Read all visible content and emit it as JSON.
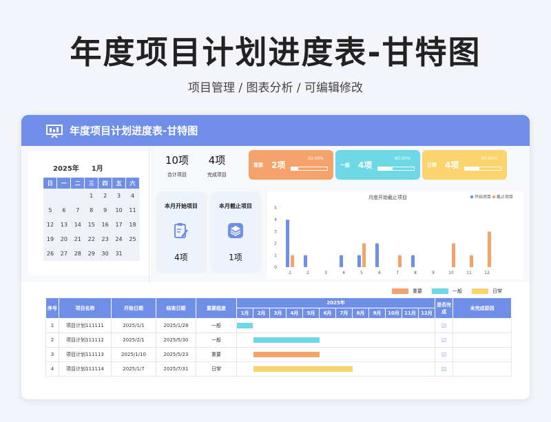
{
  "page": {
    "title": "年度项目计划进度表-甘特图",
    "subtitle": "项目管理 / 图表分析 / 可编辑修改"
  },
  "sheet": {
    "banner_title": "年度项目计划进度表-甘特图",
    "calendar": {
      "year_label": "2025年",
      "month_label": "1月",
      "weekdays": [
        "日",
        "一",
        "二",
        "三",
        "四",
        "五",
        "六"
      ],
      "weeks": [
        [
          "",
          "",
          "",
          "1",
          "2",
          "3",
          "4"
        ],
        [
          "5",
          "6",
          "7",
          "8",
          "9",
          "10",
          "11"
        ],
        [
          "12",
          "13",
          "14",
          "15",
          "16",
          "17",
          "18"
        ],
        [
          "19",
          "20",
          "21",
          "22",
          "23",
          "24",
          "25"
        ],
        [
          "26",
          "27",
          "28",
          "29",
          "30",
          "31",
          ""
        ]
      ]
    },
    "stats": {
      "total": {
        "value": "10项",
        "label": "合计项目"
      },
      "completed": {
        "value": "4项",
        "label": "完成项目"
      }
    },
    "categories": [
      {
        "label": "重要",
        "count": "2项",
        "percent_text": "20.00%",
        "progress": 0.2,
        "color": "#f6a26b"
      },
      {
        "label": "一般",
        "count": "4项",
        "percent_text": "40.00%",
        "progress": 0.4,
        "color": "#6fd8e6"
      },
      {
        "label": "日常",
        "count": "4项",
        "percent_text": "40.00%",
        "progress": 0.4,
        "color": "#fbd46e"
      }
    ],
    "month_cards": {
      "start": {
        "title": "本月开始项目",
        "count": "4项",
        "icon": "clipboard-edit-icon"
      },
      "end": {
        "title": "本月截止项目",
        "count": "1项",
        "icon": "layers-icon"
      }
    },
    "colors": {
      "accent": "#6f8ee8",
      "start_series": "#6f8ee8",
      "end_series": "#f6a26b"
    },
    "legend": [
      {
        "label": "重要",
        "color": "#f6a26b"
      },
      {
        "label": "一般",
        "color": "#6fd8e6"
      },
      {
        "label": "日常",
        "color": "#fbd46e"
      }
    ],
    "gantt": {
      "headers": {
        "index": "序号",
        "name": "项目名称",
        "start": "开始日期",
        "end": "结束日期",
        "importance": "重要程度",
        "year": "2025年",
        "done": "是否完成",
        "reason": "未完成原因"
      },
      "months": [
        "1月",
        "2月",
        "3月",
        "4月",
        "5月",
        "6月",
        "7月",
        "8月",
        "9月",
        "10月",
        "11月",
        "12月"
      ],
      "rows": [
        {
          "index": "1",
          "name": "项目计划111111",
          "start": "2025/1/1",
          "end": "2025/1/28",
          "importance": "一般",
          "done": "☑",
          "reason": "",
          "bar_start_month": 0,
          "bar_end_month": 0.95,
          "color": "#6fd8e6"
        },
        {
          "index": "2",
          "name": "项目计划111112",
          "start": "2025/2/1",
          "end": "2025/5/30",
          "importance": "一般",
          "done": "☑",
          "reason": "",
          "bar_start_month": 1,
          "bar_end_month": 5,
          "color": "#6fd8e6"
        },
        {
          "index": "3",
          "name": "项目计划111113",
          "start": "2025/1/10",
          "end": "2025/5/23",
          "importance": "重要",
          "done": "☑",
          "reason": "",
          "bar_start_month": 1,
          "bar_end_month": 5,
          "color": "#f6a26b"
        },
        {
          "index": "4",
          "name": "项目计划111114",
          "start": "2025/1/7",
          "end": "2025/7/31",
          "importance": "日常",
          "done": "☑",
          "reason": "",
          "bar_start_month": 1,
          "bar_end_month": 7,
          "color": "#fbd46e"
        }
      ]
    }
  },
  "chart_data": {
    "type": "bar",
    "title": "月度开始截止项目",
    "categories": [
      "1",
      "2",
      "3",
      "4",
      "5",
      "6",
      "7",
      "8",
      "9",
      "10",
      "11",
      "12"
    ],
    "series": [
      {
        "name": "开始项目",
        "values": [
          4,
          1,
          0,
          1,
          1,
          2,
          0,
          1,
          0,
          0,
          0,
          0
        ]
      },
      {
        "name": "截止项目",
        "values": [
          1,
          0,
          0,
          0,
          2,
          0,
          1,
          0,
          0,
          2,
          1,
          3
        ]
      }
    ],
    "y_ticks": [
      "0",
      "1",
      "2",
      "3",
      "4",
      "5"
    ],
    "ylim": [
      0,
      5
    ],
    "legend_position": "top-right",
    "grid": false
  }
}
